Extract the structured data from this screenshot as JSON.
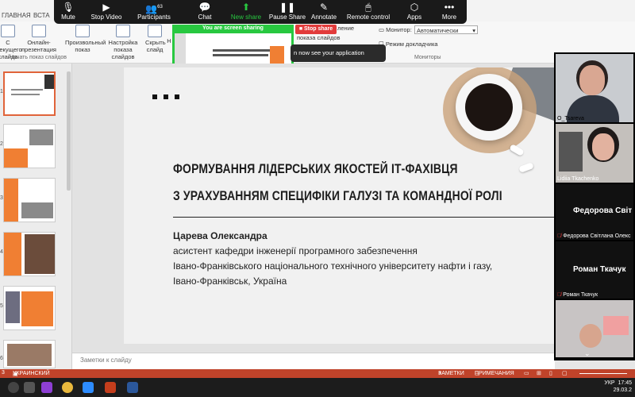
{
  "ribbon_tabs": {
    "tab1": "ГЛАВНАЯ",
    "tab2": "ВСТА"
  },
  "ribbon": {
    "from_start": "С текущего слайда",
    "online": "Онлайн-презентация",
    "custom": "Произвольный показ",
    "setup": "Настройка показа слайдов",
    "hide": "Скрыть слайд",
    "n": "Н",
    "group_start": "Начать показ слайдов",
    "setup_part": "ление",
    "show_part": "показа слайдов",
    "monitor_label": "Монитор:",
    "monitor_value": "Автоматически",
    "presenter_mode": "Режим докладчика",
    "group_monitors": "Мониторы"
  },
  "zoom": {
    "mute": "Mute",
    "stop_video": "Stop Video",
    "participants": "Participants",
    "participants_count": "63",
    "chat": "Chat",
    "new_share": "New share",
    "pause_share": "Pause Share",
    "annotate": "Annotate",
    "remote_control": "Remote control",
    "apps": "Apps",
    "more": "More",
    "sharing_banner": "You are screen sharing",
    "stop_share": "Stop share",
    "toast": "n now see your application"
  },
  "slide": {
    "title_line1": "ФОРМУВАННЯ ЛІДЕРСЬКИХ ЯКОСТЕЙ ІТ-ФАХІВЦЯ",
    "title_line2": "З УРАХУВАННЯМ СПЕЦИФІКИ ГАЛУЗІ ТА КОМАНДНОЇ РОЛІ",
    "author": "Царева Олександра",
    "position": "асистент кафедри інженерії програмного забезпечення",
    "university": "Івано-Франківського національного технічного університету нафти і газу,",
    "city": "Івано-Франківськ, Україна"
  },
  "thumbnails": {
    "numbers": [
      "1",
      "2",
      "3",
      "4",
      "5",
      "6"
    ]
  },
  "notes_placeholder": "Заметки к слайду",
  "participants": {
    "p1": "O_Tsareva",
    "p2": "Lidiia Tkachenko",
    "p3_big": "Федорова Світ",
    "p3": "Федорова Світлана Олекс",
    "p4_big": "Роман Ткачук",
    "p4": "Роман Ткачук"
  },
  "status": {
    "lang": "УКРАИНСКИЙ",
    "notes": "ЗАМЕТКИ",
    "comments": "ПРИМЕЧАНИЯ"
  },
  "taskbar": {
    "time": "17:45",
    "date": "29.03.2",
    "lang": "УКР"
  },
  "colors": {
    "accent": "#f07f33",
    "zoom_green": "#28c840",
    "status_bar": "#c0432a",
    "stop_red": "#e23b3b"
  }
}
